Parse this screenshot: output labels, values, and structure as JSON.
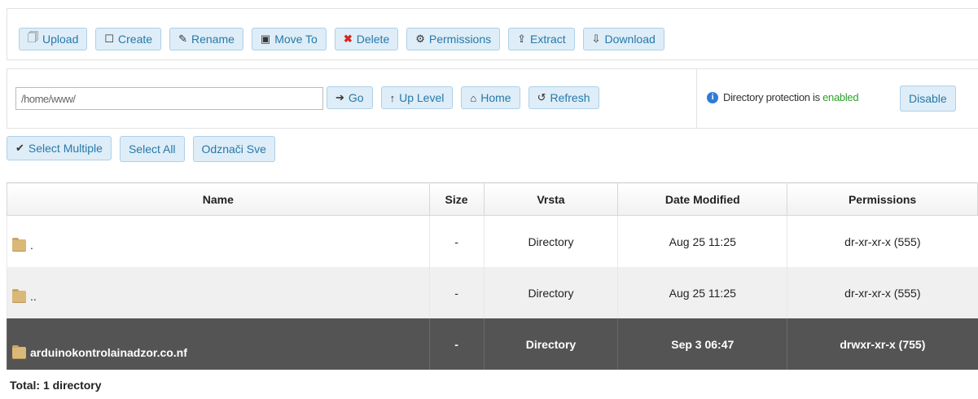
{
  "toolbar": {
    "upload": "Upload",
    "create": "Create",
    "rename": "Rename",
    "move_to": "Move To",
    "delete": "Delete",
    "permissions": "Permissions",
    "extract": "Extract",
    "download": "Download"
  },
  "pathbar": {
    "path_value": "/home/www/",
    "go": "Go",
    "up_level": "Up Level",
    "home": "Home",
    "refresh": "Refresh"
  },
  "protection": {
    "text_prefix": "Directory protection is ",
    "status": "enabled",
    "disable": "Disable"
  },
  "selection": {
    "select_multiple": "Select Multiple",
    "select_all": "Select All",
    "deselect_all": "Odznači Sve"
  },
  "table": {
    "headers": [
      "Name",
      "Size",
      "Vrsta",
      "Date Modified",
      "Permissions"
    ],
    "rows": [
      {
        "name": ".",
        "size": "-",
        "type": "Directory",
        "modified": "Aug 25 11:25",
        "permissions": "dr-xr-xr-x (555)"
      },
      {
        "name": "..",
        "size": "-",
        "type": "Directory",
        "modified": "Aug 25 11:25",
        "permissions": "dr-xr-xr-x (555)"
      },
      {
        "name": "arduinokontrolainadzor.co.nf",
        "size": "-",
        "type": "Directory",
        "modified": "Sep 3 06:47",
        "permissions": "drwxr-xr-x (755)"
      }
    ]
  },
  "total": "Total: 1 directory",
  "colors": {
    "button_bg": "#deedf7",
    "button_text": "#2779aa",
    "selected_row_bg": "#545454",
    "enabled_green": "#2ea12e"
  }
}
